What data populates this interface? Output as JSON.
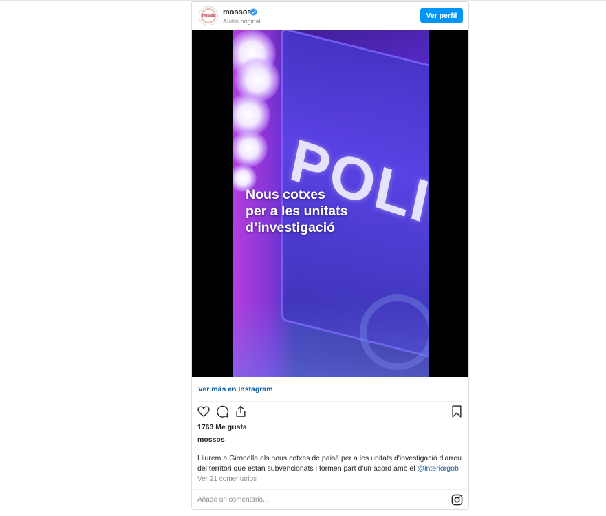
{
  "header": {
    "username": "mossos",
    "avatar_text": "mossos",
    "subtitle": "Audio original",
    "profile_button": "Ver perfil",
    "verified_color": "#3897f0"
  },
  "media": {
    "overlay_text_line1": "Nous cotxes",
    "overlay_text_line2": "per a les unitats",
    "overlay_text_line3": "d’investigació",
    "background_text": "POLICIA"
  },
  "footer": {
    "view_more": "Ver más en Instagram",
    "likes": "1763 Me gusta",
    "owner": "mossos",
    "caption_text": "Lliurem a Gironella els nous cotxes de paisà per a les unitats d'investigació d'arreu del territori que estan subvencionats i formen part d'un acord amb el ",
    "caption_mention": "@interiorgob",
    "comments_link": "Ver 21 comentarios",
    "comment_placeholder": "Añade un comentario...",
    "icons": [
      "heart-icon",
      "comment-icon",
      "share-icon",
      "bookmark-icon",
      "instagram-icon"
    ]
  },
  "colors": {
    "accent": "#0095f6",
    "link": "#00376b",
    "muted": "#8e8e8e"
  }
}
